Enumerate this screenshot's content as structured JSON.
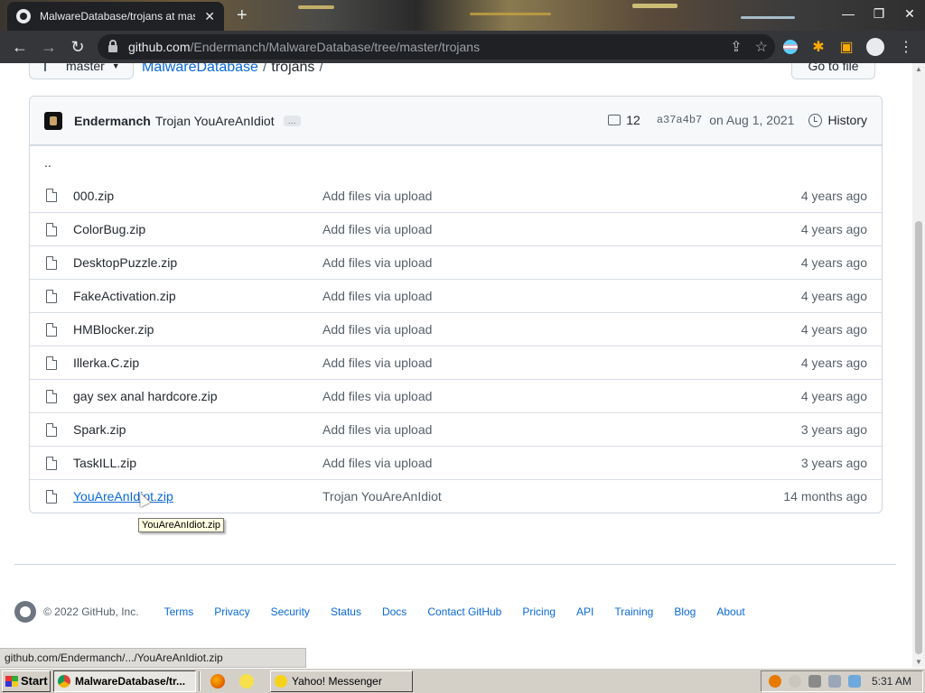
{
  "browser": {
    "tab_title": "MalwareDatabase/trojans at master",
    "tab_close": "✕",
    "new_tab": "+",
    "window_controls": [
      "—",
      "❐",
      "✕"
    ],
    "url_domain": "github.com",
    "url_path": "/Endermanch/MalwareDatabase/tree/master/trojans",
    "status_url": "github.com/Endermanch/.../YouAreAnIdiot.zip"
  },
  "repo": {
    "branch": "master",
    "repo_name": "MalwareDatabase",
    "folder": "trojans",
    "crumb_sep": "/",
    "go_to_file": "Go to file"
  },
  "commit": {
    "author": "Endermanch",
    "message": "Trojan YouAreAnIdiot",
    "ellipsis": "…",
    "comments": "12",
    "sha": "a37a4b7",
    "date": "on Aug 1, 2021",
    "history": "History"
  },
  "parent_dir": "..",
  "files": [
    {
      "name": "000.zip",
      "message": "Add files via upload",
      "age": "4 years ago"
    },
    {
      "name": "ColorBug.zip",
      "message": "Add files via upload",
      "age": "4 years ago"
    },
    {
      "name": "DesktopPuzzle.zip",
      "message": "Add files via upload",
      "age": "4 years ago"
    },
    {
      "name": "FakeActivation.zip",
      "message": "Add files via upload",
      "age": "4 years ago"
    },
    {
      "name": "HMBlocker.zip",
      "message": "Add files via upload",
      "age": "4 years ago"
    },
    {
      "name": "Illerka.C.zip",
      "message": "Add files via upload",
      "age": "4 years ago"
    },
    {
      "name": "gay sex anal hardcore.zip",
      "message": "Add files via upload",
      "age": "4 years ago"
    },
    {
      "name": "Spark.zip",
      "message": "Add files via upload",
      "age": "3 years ago"
    },
    {
      "name": "TaskILL.zip",
      "message": "Add files via upload",
      "age": "3 years ago"
    },
    {
      "name": "YouAreAnIdiot.zip",
      "message": "Trojan YouAreAnIdiot",
      "age": "14 months ago"
    }
  ],
  "tooltip": "YouAreAnIdiot.zip",
  "footer": {
    "copyright": "© 2022 GitHub, Inc.",
    "links": [
      "Terms",
      "Privacy",
      "Security",
      "Status",
      "Docs",
      "Contact GitHub",
      "Pricing",
      "API",
      "Training",
      "Blog",
      "About"
    ]
  },
  "taskbar": {
    "start": "Start",
    "tasks": [
      "MalwareDatabase/tr...",
      "Yahoo! Messenger"
    ],
    "clock": "5:31 AM"
  },
  "colors": {
    "link": "#0969da",
    "chrome_dark": "#35363a",
    "taskbar": "#d4d0c8"
  }
}
